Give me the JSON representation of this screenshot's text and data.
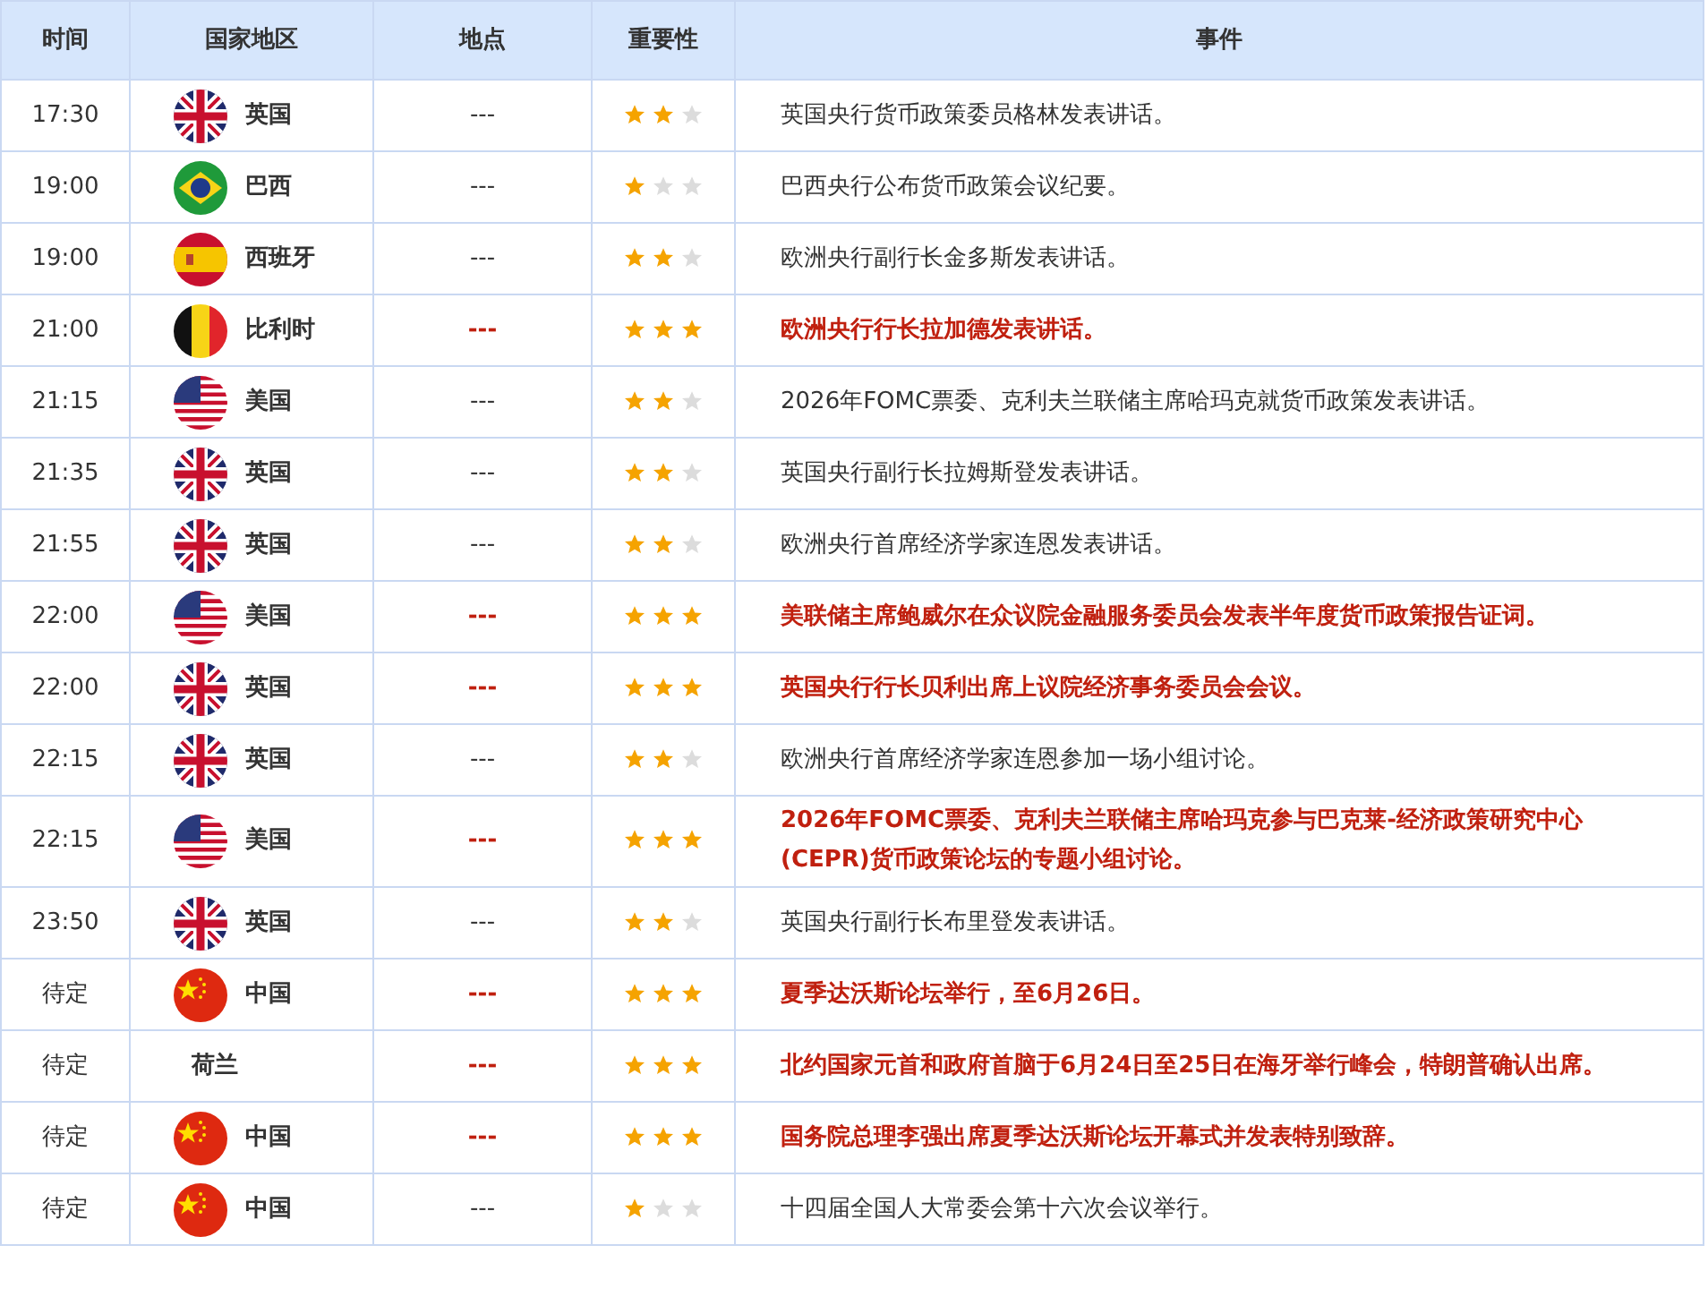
{
  "table": {
    "columns": [
      "时间",
      "国家地区",
      "地点",
      "重要性",
      "事件"
    ],
    "rows": [
      {
        "time": "17:30",
        "kind": "gb",
        "country": "英国",
        "place": "---",
        "stars": 2,
        "important": false,
        "event": "英国央行货币政策委员格林发表讲话。"
      },
      {
        "time": "19:00",
        "kind": "br",
        "country": "巴西",
        "place": "---",
        "stars": 1,
        "important": false,
        "event": "巴西央行公布货币政策会议纪要。"
      },
      {
        "time": "19:00",
        "kind": "es",
        "country": "西班牙",
        "place": "---",
        "stars": 2,
        "important": false,
        "event": "欧洲央行副行长金多斯发表讲话。"
      },
      {
        "time": "21:00",
        "kind": "be",
        "country": "比利时",
        "place": "---",
        "stars": 3,
        "important": true,
        "event": "欧洲央行行长拉加德发表讲话。"
      },
      {
        "time": "21:15",
        "kind": "us",
        "country": "美国",
        "place": "---",
        "stars": 2,
        "important": false,
        "event": "2026年FOMC票委、克利夫兰联储主席哈玛克就货币政策发表讲话。"
      },
      {
        "time": "21:35",
        "kind": "gb",
        "country": "英国",
        "place": "---",
        "stars": 2,
        "important": false,
        "event": "英国央行副行长拉姆斯登发表讲话。"
      },
      {
        "time": "21:55",
        "kind": "gb",
        "country": "英国",
        "place": "---",
        "stars": 2,
        "important": false,
        "event": "欧洲央行首席经济学家连恩发表讲话。"
      },
      {
        "time": "22:00",
        "kind": "us",
        "country": "美国",
        "place": "---",
        "stars": 3,
        "important": true,
        "event": "美联储主席鲍威尔在众议院金融服务委员会发表半年度货币政策报告证词。"
      },
      {
        "time": "22:00",
        "kind": "gb",
        "country": "英国",
        "place": "---",
        "stars": 3,
        "important": true,
        "event": "英国央行行长贝利出席上议院经济事务委员会会议。"
      },
      {
        "time": "22:15",
        "kind": "gb",
        "country": "英国",
        "place": "---",
        "stars": 2,
        "important": false,
        "event": "欧洲央行首席经济学家连恩参加一场小组讨论。"
      },
      {
        "time": "22:15",
        "kind": "us",
        "country": "美国",
        "place": "---",
        "stars": 3,
        "important": true,
        "event": "2026年FOMC票委、克利夫兰联储主席哈玛克参与巴克莱-经济政策研究中心(CEPR)货币政策论坛的专题小组讨论。"
      },
      {
        "time": "23:50",
        "kind": "gb",
        "country": "英国",
        "place": "---",
        "stars": 2,
        "important": false,
        "event": "英国央行副行长布里登发表讲话。"
      },
      {
        "time": "待定",
        "kind": "cn",
        "country": "中国",
        "place": "---",
        "stars": 3,
        "important": true,
        "event": "夏季达沃斯论坛举行，至6月26日。"
      },
      {
        "time": "待定",
        "kind": "none",
        "country": "荷兰",
        "place": "---",
        "stars": 3,
        "important": true,
        "event": "北约国家元首和政府首脑于6月24日至25日在海牙举行峰会，特朗普确认出席。"
      },
      {
        "time": "待定",
        "kind": "cn",
        "country": "中国",
        "place": "---",
        "stars": 3,
        "important": true,
        "event": "国务院总理李强出席夏季达沃斯论坛开幕式并发表特别致辞。"
      },
      {
        "time": "待定",
        "kind": "cn",
        "country": "中国",
        "place": "---",
        "stars": 1,
        "important": false,
        "event": "十四届全国人大常委会第十六次会议举行。"
      }
    ]
  }
}
